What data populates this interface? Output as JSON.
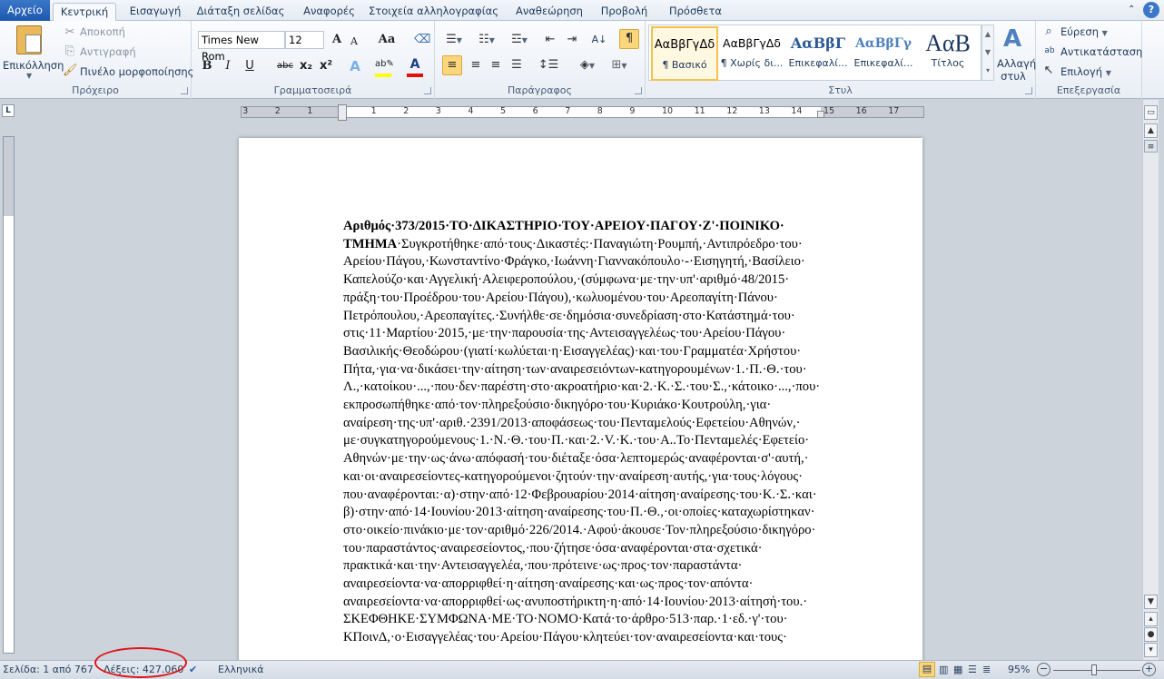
{
  "tabs": {
    "file": "Αρχείο",
    "items": [
      "Κεντρική",
      "Εισαγωγή",
      "Διάταξη σελίδας",
      "Αναφορές",
      "Στοιχεία αλληλογραφίας",
      "Αναθεώρηση",
      "Προβολή",
      "Πρόσθετα"
    ],
    "active": "Κεντρική"
  },
  "ribbon": {
    "clipboard": {
      "label": "Πρόχειρο",
      "paste": "Επικόλληση",
      "cut": "Αποκοπή",
      "copy": "Αντιγραφή",
      "format_painter": "Πινέλο μορφοποίησης"
    },
    "font": {
      "label": "Γραμματοσειρά",
      "font_name": "Times New Rom",
      "font_size": "12",
      "bold": "B",
      "italic": "I",
      "underline": "U",
      "strike": "abc",
      "sub": "x₂",
      "sup": "x²",
      "grow": "A",
      "shrink": "A",
      "case": "Aa",
      "highlight_color": "#ffff00",
      "font_color": "#e01010"
    },
    "paragraph": {
      "label": "Παράγραφος",
      "show_marks_active": true,
      "align_active": "left"
    },
    "styles": {
      "label": "Στυλ",
      "items": [
        {
          "sample": "ΑαΒβΓγΔδ",
          "name": "¶ Βασικό",
          "selected": true
        },
        {
          "sample": "ΑαΒβΓγΔδ",
          "name": "¶ Χωρίς δι..."
        },
        {
          "sample": "ΑαΒβΓ",
          "name": "Επικεφαλί..."
        },
        {
          "sample": "ΑαΒβΓγ",
          "name": "Επικεφαλί..."
        },
        {
          "sample": "ΑαΒ",
          "name": "Τίτλος"
        }
      ],
      "change_styles_1": "Αλλαγή",
      "change_styles_2": "στυλ"
    },
    "editing": {
      "label": "Επεξεργασία",
      "find": "Εύρεση",
      "replace": "Αντικατάσταση",
      "select": "Επιλογή"
    }
  },
  "ruler": {
    "left_numbers": [
      "3",
      "2",
      "1"
    ],
    "right_numbers": [
      "1",
      "2",
      "3",
      "4",
      "5",
      "6",
      "7",
      "8",
      "9",
      "10",
      "11",
      "12",
      "13",
      "14",
      "15",
      "16",
      "17"
    ]
  },
  "document": {
    "line1_bold": "Αριθμός·373/2015·ΤΟ·ΔΙΚΑΣΤΗΡΙΟ·ΤΟΥ·ΑΡΕΙΟΥ·ΠΑΓΟΥ·Ζ'·ΠΟΙΝΙΚΟ·",
    "line2_bold": "ΤΜΗΜΑ",
    "line2_rest": "·Συγκροτήθηκε·από·τους·Δικαστές:·Παναγιώτη·Ρουμπή,·Αντιπρόεδρο·του·",
    "lines": [
      "Αρείου·Πάγου,·Κωνσταντίνο·Φράγκο,·Ιωάννη·Γιαννακόπουλο·-·Εισηγητή,·Βασίλειο·",
      "Καπελούζο·και·Αγγελική·Αλειφεροπούλου,·(σύμφωνα·με·την·υπ'·αριθμό·48/2015·",
      "πράξη·του·Προέδρου·του·Αρείου·Πάγου),·κωλυομένου·του·Αρεοπαγίτη·Πάνου·",
      "Πετρόπουλου,·Αρεοπαγίτες.·Συνήλθε·σε·δημόσια·συνεδρίαση·στο·Κατάστημά·του·",
      "στις·11·Μαρτίου·2015,·με·την·παρουσία·της·Αντεισαγγελέως·του·Αρείου·Πάγου·",
      "Βασιλικής·Θεοδώρου·(γιατί·κωλύεται·η·Εισαγγελέας)·και·του·Γραμματέα·Χρήστου·",
      "Πήτα,·για·να·δικάσει·την·αίτηση·των·αναιρεσειόντων-κατηγορουμένων·1.·Π.·Θ.·του·",
      "Λ.,·κατοίκου·...,·που·δεν·παρέστη·στο·ακροατήριο·και·2.·Κ.·Σ.·του·Σ.,·κάτοικο·...,·που·",
      "εκπροσωπήθηκε·από·τον·πληρεξούσιο·δικηγόρο·του·Κυριάκο·Κουτρούλη,·για·",
      "αναίρεση·της·υπ'·αριθ.·2391/2013·αποφάσεως·του·Πενταμελούς·Εφετείου·Αθηνών,·",
      "με·συγκατηγορούμενους·1.·Ν.·Θ.·του·Π.·και·2.·V.·Κ.·του·Α..Το·Πενταμελές·Εφετείο·",
      "Αθηνών·με·την·ως·άνω·απόφασή·του·διέταξε·όσα·λεπτομερώς·αναφέρονται·σ'·αυτή,·",
      "και·οι·αναιρεσείοντες-κατηγορούμενοι·ζητούν·την·αναίρεση·αυτής,·για·τους·λόγους·",
      "που·αναφέρονται:·α)·στην·από·12·Φεβρουαρίου·2014·αίτηση·αναίρεσης·του·Κ.·Σ.·και·",
      "β)·στην·από·14·Ιουνίου·2013·αίτηση·αναίρεσης·του·Π.·Θ.,·οι·οποίες·καταχωρίστηκαν·",
      "στο·οικείο·πινάκιο·με·τον·αριθμό·226/2014.·Αφού·άκουσε·Τον·πληρεξούσιο·δικηγόρο·",
      "του·παραστάντος·αναιρεσείοντος,·που·ζήτησε·όσα·αναφέρονται·στα·σχετικά·",
      "πρακτικά·και·την·Αντεισαγγελέα,·που·πρότεινε·ως·προς·τον·παραστάντα·",
      "αναιρεσείοντα·να·απορριφθεί·η·αίτηση·αναίρεσης·και·ως·προς·τον·απόντα·",
      "αναιρεσείοντα·να·απορριφθεί·ως·ανυποστήρικτη·η·από·14·Ιουνίου·2013·αίτησή·του.·",
      "ΣΚΕΦΘΗΚΕ·ΣΥΜΦΩΝΑ·ΜΕ·ΤΟ·ΝΟΜΟ·Κατά·το·άρθρο·513·παρ.·1·εδ.·γ'·του·",
      "ΚΠοινΔ,·ο·Εισαγγελέας·του·Αρείου·Πάγου·κλητεύει·τον·αναιρεσείοντα·και·τους·"
    ]
  },
  "status": {
    "page": "Σελίδα: 1 από 767",
    "words": "Λέξεις: 427.060",
    "language": "Ελληνικά",
    "zoom": "95%",
    "zoom_level": 95,
    "highlight_color": "#e0141a"
  }
}
